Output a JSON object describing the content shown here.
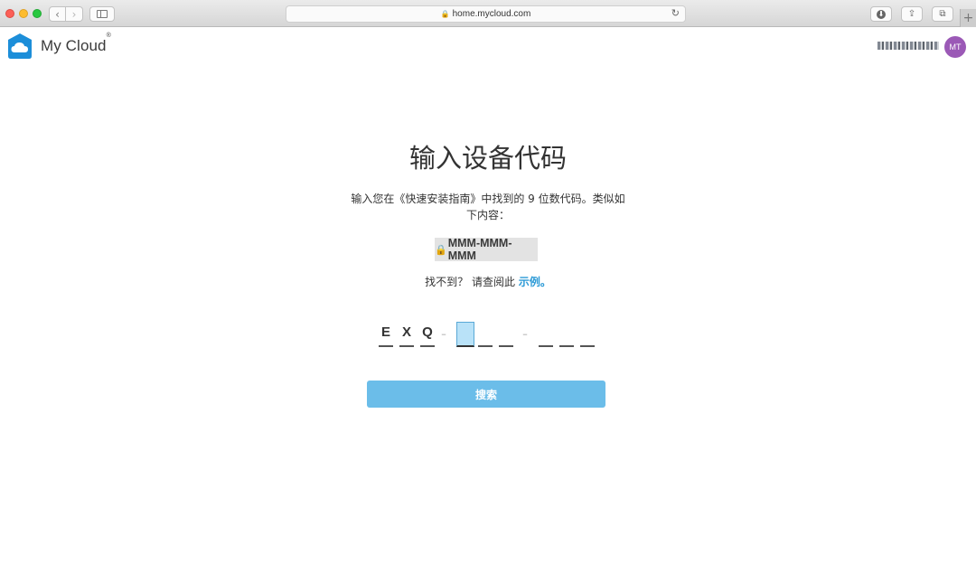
{
  "browser": {
    "url": "home.mycloud.com",
    "back_glyph": "‹",
    "forward_glyph": "›",
    "reload_glyph": "↻",
    "download_glyph": "⬇",
    "share_glyph": "⇪",
    "tabs_glyph": "⧉",
    "newtab_glyph": "+",
    "lock_glyph": "🔒"
  },
  "header": {
    "brand": "My Cloud",
    "brand_mark": "®",
    "avatar_initials": "MT",
    "logo_color": "#1c8ed9"
  },
  "main": {
    "title": "输入设备代码",
    "description": "输入您在《快速安装指南》中找到的 9 位数代码。类似如下内容：",
    "format_lock": "🔒",
    "format_example": "MMM-MMM-MMM",
    "help_prefix": "找不到？ 请查阅此",
    "help_link": "示例。",
    "code": {
      "groups": [
        [
          "E",
          "X",
          "Q"
        ],
        [
          "",
          "",
          ""
        ],
        [
          "",
          "",
          ""
        ]
      ],
      "active_index": 3,
      "separator": "–"
    },
    "search_button": "搜索"
  },
  "colors": {
    "accent": "#2c9ad6",
    "button": "#6bbde9",
    "active_field": "#b9e2f8",
    "avatar": "#9b59b6"
  }
}
